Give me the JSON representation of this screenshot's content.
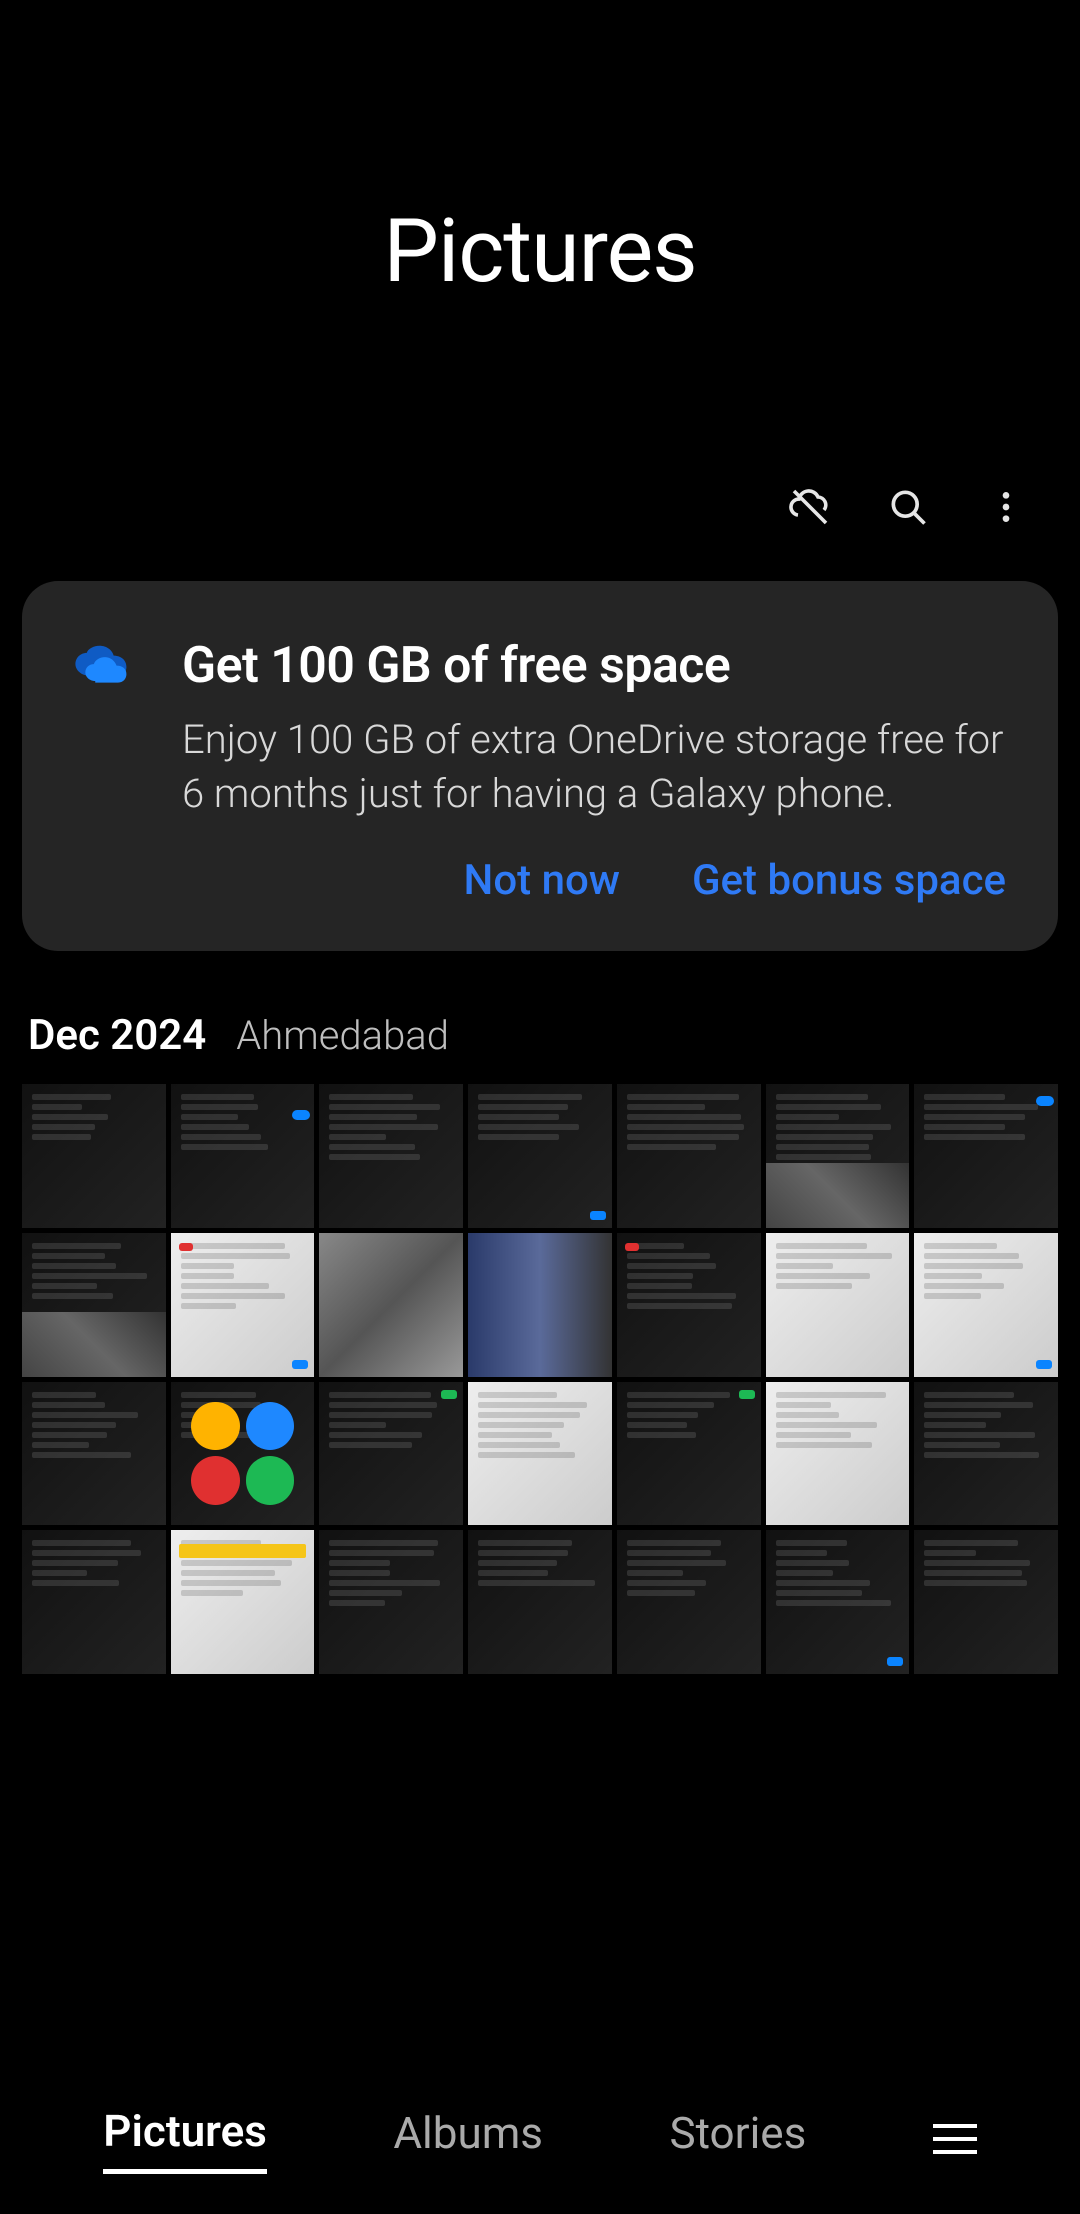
{
  "header": {
    "title": "Pictures"
  },
  "promo": {
    "title": "Get 100 GB of free space",
    "description": "Enjoy 100 GB of extra OneDrive storage free for 6 months just for having a Galaxy phone.",
    "not_now": "Not now",
    "get_bonus": "Get bonus space"
  },
  "section": {
    "date": "Dec 2024",
    "location": "Ahmedabad"
  },
  "nav": {
    "pictures": "Pictures",
    "albums": "Albums",
    "stories": "Stories"
  },
  "thumbs": [
    {
      "tone": "dark",
      "hint": "gallery-self"
    },
    {
      "tone": "dark",
      "hint": "sync-settings",
      "toggles": true
    },
    {
      "tone": "dark",
      "hint": "storage-docs"
    },
    {
      "tone": "dark",
      "hint": "storage-docs-qr",
      "blue": true
    },
    {
      "tone": "dark",
      "hint": "wallpaper-nav"
    },
    {
      "tone": "dark",
      "hint": "wallpaper-building",
      "img": true
    },
    {
      "tone": "dark",
      "hint": "modes-list",
      "toggles": true
    },
    {
      "tone": "dark",
      "hint": "wallpaper-tiles",
      "img": true
    },
    {
      "tone": "light",
      "hint": "form-cancel",
      "red": true,
      "blue": true
    },
    {
      "tone": "light",
      "hint": "adidas-jacket",
      "photo": "grey"
    },
    {
      "tone": "light",
      "hint": "jackets-row",
      "photo": "blue"
    },
    {
      "tone": "dark",
      "hint": "stock-alert",
      "red": true
    },
    {
      "tone": "light",
      "hint": "feed-comments"
    },
    {
      "tone": "light",
      "hint": "transmaa-board",
      "blue": true
    },
    {
      "tone": "dark",
      "hint": "ipo-text"
    },
    {
      "tone": "dark",
      "hint": "health-icons",
      "circles": true
    },
    {
      "tone": "dark",
      "hint": "health-customise",
      "green": true
    },
    {
      "tone": "light",
      "hint": "cumulative-demand"
    },
    {
      "tone": "dark",
      "hint": "pnl-green",
      "green": true
    },
    {
      "tone": "light",
      "hint": "transmaa-list"
    },
    {
      "tone": "dark",
      "hint": "status-text"
    },
    {
      "tone": "dark",
      "hint": "discord-list"
    },
    {
      "tone": "light",
      "hint": "important-notice",
      "orange": true
    },
    {
      "tone": "dark",
      "hint": "game-booster"
    },
    {
      "tone": "dark",
      "hint": "ram-2gb"
    },
    {
      "tone": "dark",
      "hint": "ram-2gb-alt"
    },
    {
      "tone": "dark",
      "hint": "clean-now",
      "blue": true
    },
    {
      "tone": "dark",
      "hint": "optimized"
    }
  ]
}
